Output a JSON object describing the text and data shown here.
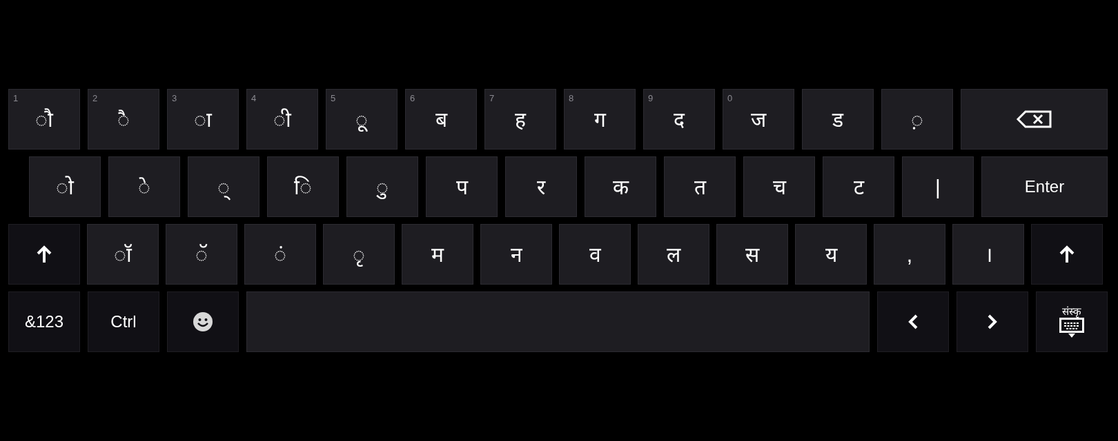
{
  "rows": [
    {
      "keys": [
        {
          "kind": "char",
          "label": "◌ौ",
          "hint": "1"
        },
        {
          "kind": "char",
          "label": "◌ै",
          "hint": "2"
        },
        {
          "kind": "char",
          "label": "◌ा",
          "hint": "3"
        },
        {
          "kind": "char",
          "label": "◌ी",
          "hint": "4"
        },
        {
          "kind": "char",
          "label": "◌ू",
          "hint": "5"
        },
        {
          "kind": "char",
          "label": "ब",
          "hint": "6"
        },
        {
          "kind": "char",
          "label": "ह",
          "hint": "7"
        },
        {
          "kind": "char",
          "label": "ग",
          "hint": "8"
        },
        {
          "kind": "char",
          "label": "द",
          "hint": "9"
        },
        {
          "kind": "char",
          "label": "ज",
          "hint": "0"
        },
        {
          "kind": "char",
          "label": "ड"
        },
        {
          "kind": "char",
          "label": "◌़"
        },
        {
          "kind": "backspace"
        }
      ]
    },
    {
      "keys": [
        {
          "kind": "char",
          "label": "◌ो"
        },
        {
          "kind": "char",
          "label": "◌े"
        },
        {
          "kind": "char",
          "label": "◌्"
        },
        {
          "kind": "char",
          "label": "◌ि"
        },
        {
          "kind": "char",
          "label": "◌ु"
        },
        {
          "kind": "char",
          "label": "प"
        },
        {
          "kind": "char",
          "label": "र"
        },
        {
          "kind": "char",
          "label": "क"
        },
        {
          "kind": "char",
          "label": "त"
        },
        {
          "kind": "char",
          "label": "च"
        },
        {
          "kind": "char",
          "label": "ट"
        },
        {
          "kind": "char",
          "label": "|"
        },
        {
          "kind": "enter",
          "label": "Enter"
        }
      ]
    },
    {
      "keys": [
        {
          "kind": "shift"
        },
        {
          "kind": "char",
          "label": "◌ॉ"
        },
        {
          "kind": "char",
          "label": "◌ॅ"
        },
        {
          "kind": "char",
          "label": "◌ं"
        },
        {
          "kind": "char",
          "label": "◌ृ"
        },
        {
          "kind": "char",
          "label": "म"
        },
        {
          "kind": "char",
          "label": "न"
        },
        {
          "kind": "char",
          "label": "व"
        },
        {
          "kind": "char",
          "label": "ल"
        },
        {
          "kind": "char",
          "label": "स"
        },
        {
          "kind": "char",
          "label": "य"
        },
        {
          "kind": "char",
          "label": ","
        },
        {
          "kind": "char",
          "label": "।"
        },
        {
          "kind": "shift"
        }
      ]
    },
    {
      "keys": [
        {
          "kind": "mode",
          "label": "&123"
        },
        {
          "kind": "mode",
          "label": "Ctrl"
        },
        {
          "kind": "emoji"
        },
        {
          "kind": "space"
        },
        {
          "kind": "left"
        },
        {
          "kind": "right"
        },
        {
          "kind": "lang",
          "label": "संस्कृ"
        }
      ]
    }
  ]
}
